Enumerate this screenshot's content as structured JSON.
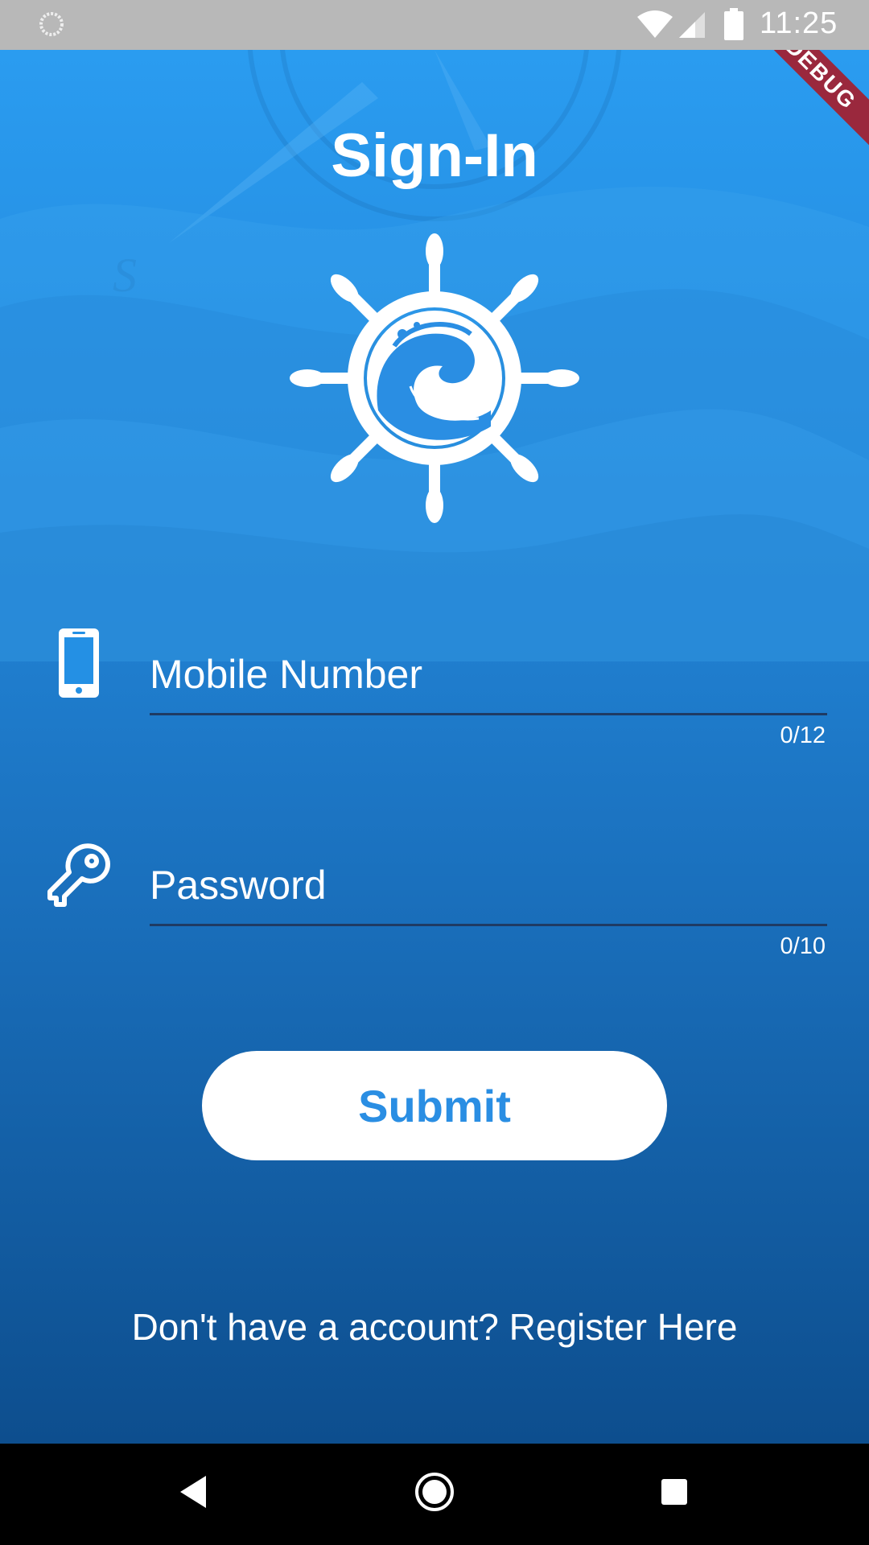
{
  "status_bar": {
    "time": "11:25",
    "icons": [
      "loading-icon",
      "wifi-icon",
      "cell-signal-icon",
      "battery-icon"
    ]
  },
  "page": {
    "title": "Sign-In",
    "logo": "ship-wheel-wave-logo"
  },
  "form": {
    "mobile": {
      "icon": "smartphone-icon",
      "placeholder": "Mobile Number",
      "value": "",
      "counter": "0/12"
    },
    "password": {
      "icon": "key-icon",
      "placeholder": "Password",
      "value": "",
      "counter": "0/10"
    },
    "submit_label": "Submit"
  },
  "footer": {
    "register_text": "Don't have a account? Register Here"
  },
  "debug_banner": "DEBUG",
  "nav_bar": {
    "icons": [
      "back-icon",
      "home-icon",
      "recents-icon"
    ]
  },
  "colors": {
    "gradient_top": "#2a9cf0",
    "gradient_bottom": "#0d4e8e",
    "accent": "#2a8ee3",
    "field_underline": "#1f3b63"
  }
}
